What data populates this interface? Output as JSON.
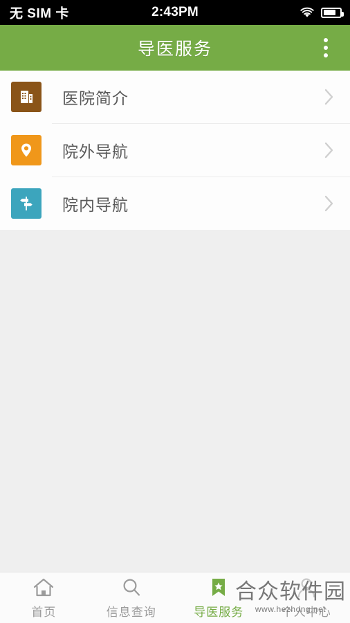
{
  "status_bar": {
    "carrier": "无 SIM 卡",
    "time": "2:43PM",
    "wifi_icon": "wifi-icon",
    "battery_icon": "battery-icon"
  },
  "header": {
    "title": "导医服务",
    "overflow_icon": "overflow-menu-icon",
    "background_color": "#76ac46"
  },
  "list": {
    "items": [
      {
        "label": "医院简介",
        "icon": "building-icon",
        "icon_color": "#8a5418",
        "chevron_icon": "chevron-right-icon"
      },
      {
        "label": "院外导航",
        "icon": "map-pin-icon",
        "icon_color": "#f0971a",
        "chevron_icon": "chevron-right-icon"
      },
      {
        "label": "院内导航",
        "icon": "signpost-icon",
        "icon_color": "#3ca5bd",
        "chevron_icon": "chevron-right-icon"
      }
    ]
  },
  "tab_bar": {
    "active_color": "#76ac46",
    "inactive_color": "#9b9b9b",
    "tabs": [
      {
        "label": "首页",
        "icon": "home-icon",
        "active": false
      },
      {
        "label": "信息查询",
        "icon": "search-icon",
        "active": false
      },
      {
        "label": "导医服务",
        "icon": "bookmark-star-icon",
        "active": true
      },
      {
        "label": "个人中心",
        "icon": "person-icon",
        "active": false
      }
    ]
  },
  "watermark": {
    "text": "合众软件园",
    "url": "www.hezhong.net"
  }
}
